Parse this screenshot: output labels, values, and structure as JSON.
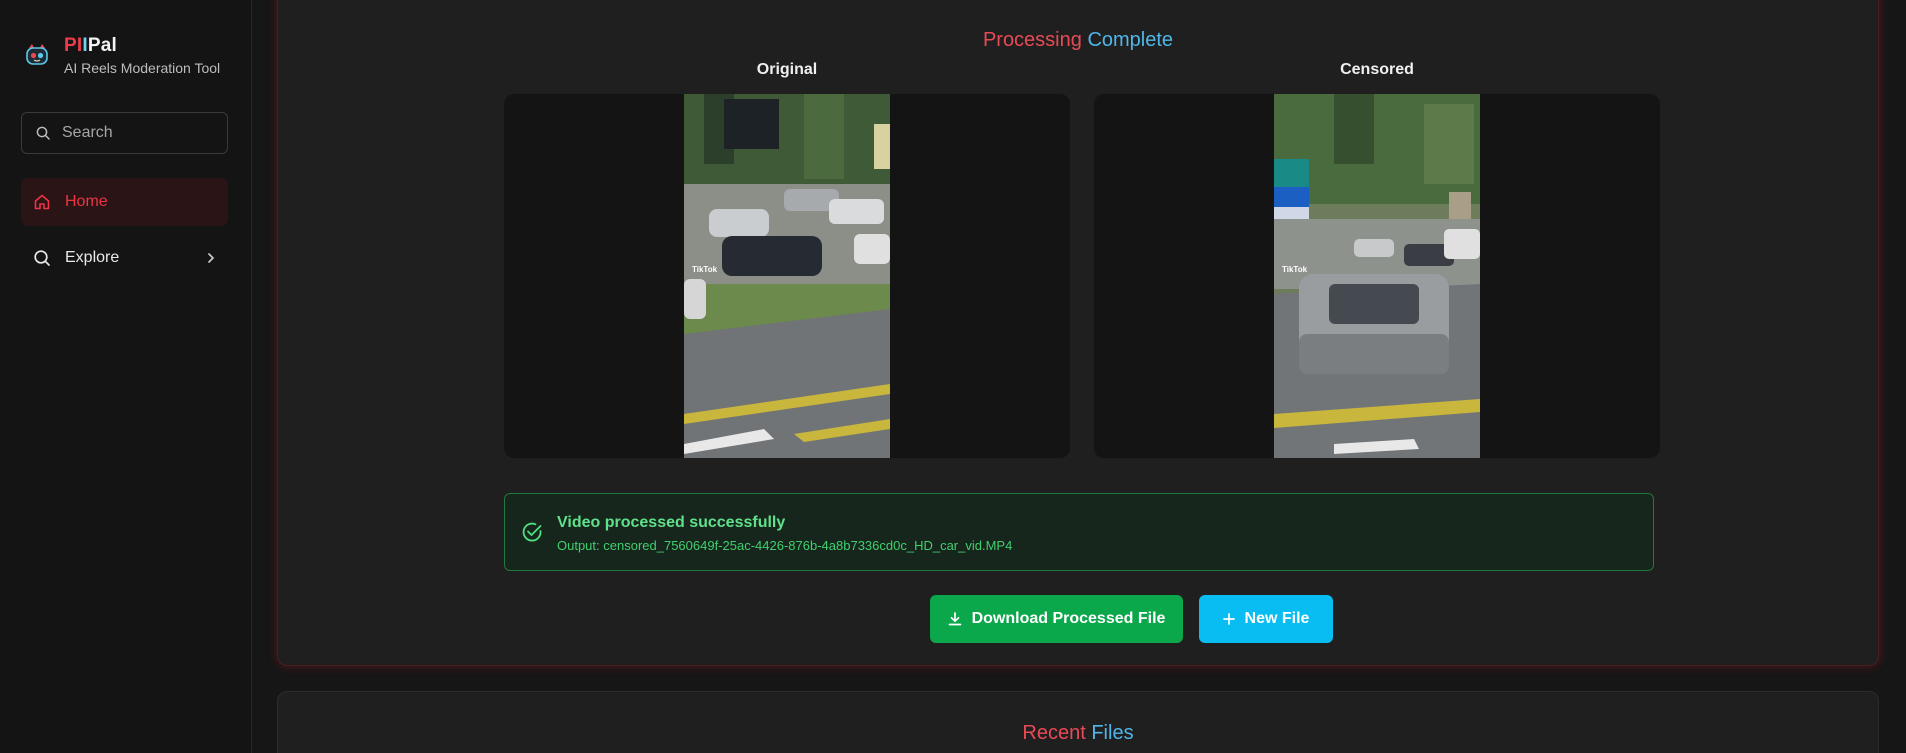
{
  "brand": {
    "name_part1": "PI",
    "name_part2": "I",
    "name_part3": "Pal",
    "subtitle": "AI Reels Moderation Tool"
  },
  "search": {
    "placeholder": "Search"
  },
  "nav": {
    "items": [
      {
        "label": "Home",
        "icon": "home-icon",
        "active": true
      },
      {
        "label": "Explore",
        "icon": "search-icon",
        "active": false
      }
    ]
  },
  "processing": {
    "title_word1": "Processing",
    "title_word2": "Complete",
    "original_label": "Original",
    "censored_label": "Censored",
    "overlay_text": "TikTok"
  },
  "status": {
    "title": "Video processed successfully",
    "output_label": "Output:",
    "output_value": "censored_7560649f-25ac-4426-876b-4a8b7336cd0c_HD_car_vid.MP4"
  },
  "actions": {
    "download_label": "Download Processed File",
    "new_file_label": "New File"
  },
  "recent": {
    "title_word1": "Recent",
    "title_word2": "Files"
  },
  "colors": {
    "accent_red": "#ee3344",
    "accent_blue": "#4fb6e8",
    "success_green": "#0aa84a",
    "cyan": "#08bdf2"
  }
}
